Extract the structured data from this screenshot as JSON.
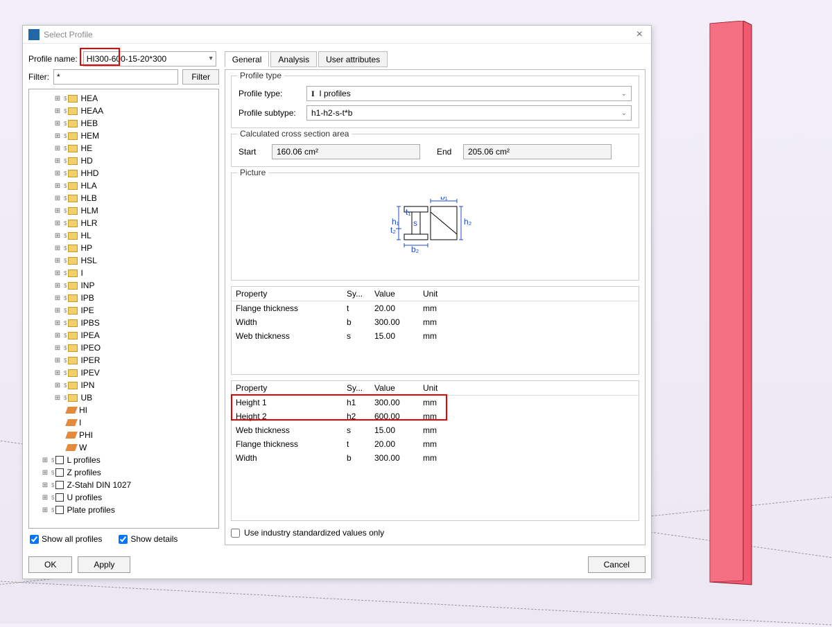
{
  "window": {
    "title": "Select Profile"
  },
  "profileNameLabel": "Profile name:",
  "profileName": "HI300-600-15-20*300",
  "tabs": {
    "general": "General",
    "analysis": "Analysis",
    "user": "User attributes"
  },
  "filterLabel": "Filter:",
  "filterValue": "*",
  "filterBtn": "Filter",
  "tree": {
    "l1": [
      "HEA",
      "HEAA",
      "HEB",
      "HEM",
      "HE",
      "HD",
      "HHD",
      "HLA",
      "HLB",
      "HLM",
      "HLR",
      "HL",
      "HP",
      "HSL",
      "I",
      "INP",
      "IPB",
      "IPE",
      "IPBS",
      "IPEA",
      "IPEO",
      "IPER",
      "IPEV",
      "IPN",
      "UB"
    ],
    "l2": [
      "HI",
      "I",
      "PHI",
      "W"
    ],
    "l0": [
      "L profiles",
      "Z profiles",
      "Z-Stahl DIN 1027",
      "U profiles",
      "Plate profiles"
    ]
  },
  "showAll": "Show all profiles",
  "showDetails": "Show details",
  "profileTypeGroup": "Profile type",
  "profileTypeLabel": "Profile type:",
  "profileTypeValue": "I profiles",
  "profileSubtypeLabel": "Profile subtype:",
  "profileSubtypeValue": "h1-h2-s-t*b",
  "calcGroup": "Calculated cross section area",
  "startLabel": "Start",
  "startVal": "160.06 cm²",
  "endLabel": "End",
  "endVal": "205.06 cm²",
  "pictureGroup": "Picture",
  "table1": {
    "headers": [
      "Property",
      "Sy...",
      "Value",
      "Unit"
    ],
    "rows": [
      [
        "Flange thickness",
        "t",
        "20.00",
        "mm"
      ],
      [
        "Width",
        "b",
        "300.00",
        "mm"
      ],
      [
        "Web thickness",
        "s",
        "15.00",
        "mm"
      ]
    ]
  },
  "table2": {
    "headers": [
      "Property",
      "Sy...",
      "Value",
      "Unit"
    ],
    "rows": [
      [
        "Height 1",
        "h1",
        "300.00",
        "mm"
      ],
      [
        "Height 2",
        "h2",
        "600.00",
        "mm"
      ],
      [
        "Web thickness",
        "s",
        "15.00",
        "mm"
      ],
      [
        "Flange thickness",
        "t",
        "20.00",
        "mm"
      ],
      [
        "Width",
        "b",
        "300.00",
        "mm"
      ]
    ]
  },
  "industryCheck": "Use industry standardized values only",
  "buttons": {
    "ok": "OK",
    "apply": "Apply",
    "cancel": "Cancel"
  }
}
